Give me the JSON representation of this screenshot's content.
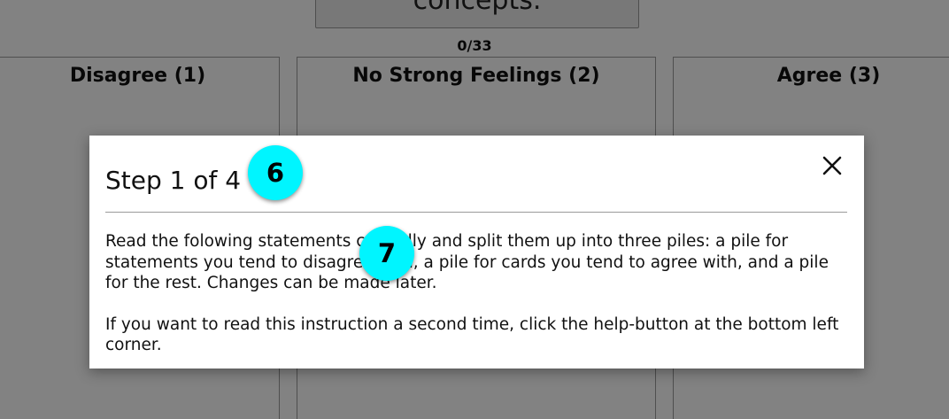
{
  "background": {
    "top_card_text": "concepts.",
    "counter": "0/33",
    "columns": [
      {
        "title": "Disagree (1)"
      },
      {
        "title": "No Strong Feelings (2)"
      },
      {
        "title": "Agree (3)"
      }
    ]
  },
  "modal": {
    "title": "Step 1 of 4",
    "close_icon": "close-icon",
    "paragraphs": [
      "Read the folowing statements carefully and split them up into three piles: a pile for statements you tend to disagree with, a pile for cards you tend to agree with, and a pile for the rest. Changes can be made later.",
      "If you want to read this instruction a second time, click the help-button at the bottom left corner."
    ]
  },
  "markers": [
    {
      "label": "6"
    },
    {
      "label": "7"
    }
  ],
  "colors": {
    "marker": "#00f5ff",
    "overlay": "rgba(0,0,0,0.49)"
  }
}
